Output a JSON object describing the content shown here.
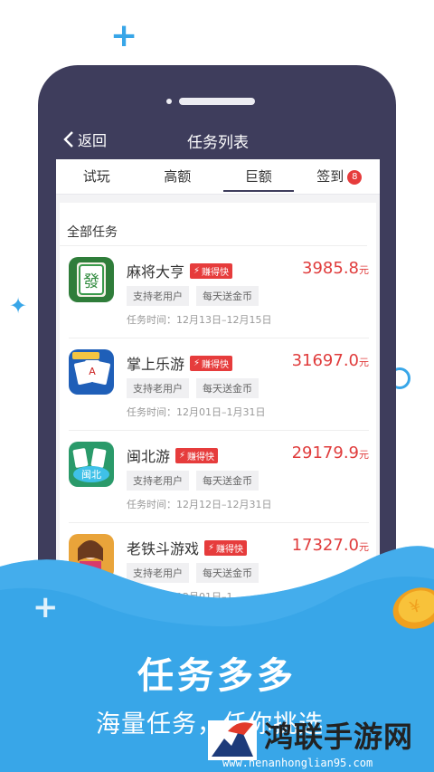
{
  "colors": {
    "accent": "#38a6e8",
    "phone": "#3e3d5c",
    "price": "#e03c3c",
    "badge": "#e63c3c"
  },
  "header": {
    "back_label": "返回",
    "title": "任务列表"
  },
  "tabs": [
    {
      "label": "试玩"
    },
    {
      "label": "高额"
    },
    {
      "label": "巨额",
      "active": true
    },
    {
      "label": "签到",
      "badge": "8"
    }
  ],
  "section_title": "全部任务",
  "tasks": [
    {
      "name": "麻将大亨",
      "hot_label": "赚得快",
      "amount": "3985.8",
      "unit": "元",
      "tags": [
        "支持老用户",
        "每天送金币"
      ],
      "time": "任务时间：12月13日–12月15日"
    },
    {
      "name": "掌上乐游",
      "hot_label": "赚得快",
      "amount": "31697.0",
      "unit": "元",
      "tags": [
        "支持老用户",
        "每天送金币"
      ],
      "time": "任务时间：12月01日–1月31日"
    },
    {
      "name": "闽北游",
      "hot_label": "赚得快",
      "amount": "29179.9",
      "unit": "元",
      "tags": [
        "支持老用户",
        "每天送金币"
      ],
      "time": "任务时间：12月12日–12月31日"
    },
    {
      "name": "老铁斗游戏",
      "hot_label": "赚得快",
      "amount": "17327.0",
      "unit": "元",
      "tags": [
        "支持老用户",
        "每天送金币"
      ],
      "time": "任务时间：12月01日–1"
    }
  ],
  "promo": {
    "headline": "任务多多",
    "subline": "海量任务，任你挑选"
  },
  "watermark": {
    "name": "鸿联手游网",
    "url": "www.henanhonglian95.com"
  }
}
